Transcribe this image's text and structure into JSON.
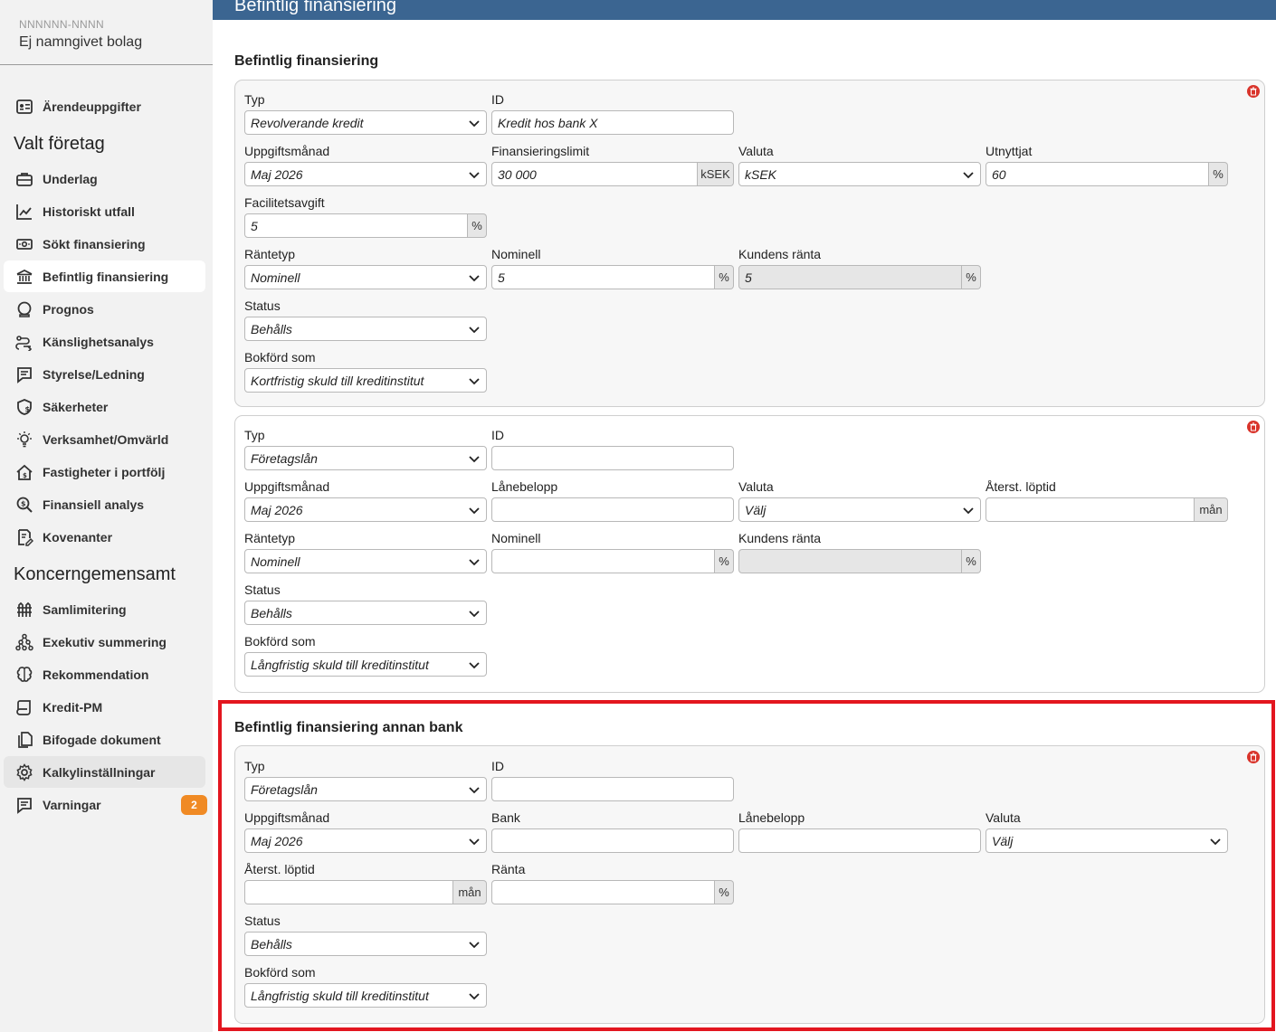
{
  "sidebar": {
    "company_id": "NNNNNN-NNNN",
    "company_name": "Ej namngivet bolag",
    "items_top": [
      {
        "label": "Ärendeuppgifter",
        "icon": "id-card-icon"
      }
    ],
    "section1": "Valt företag",
    "items1": [
      {
        "label": "Underlag",
        "icon": "briefcase-icon"
      },
      {
        "label": "Historiskt utfall",
        "icon": "chart-icon"
      },
      {
        "label": "Sökt finansiering",
        "icon": "money-icon"
      },
      {
        "label": "Befintlig finansiering",
        "icon": "bank-icon"
      },
      {
        "label": "Prognos",
        "icon": "crystal-ball-icon"
      },
      {
        "label": "Känslighetsanalys",
        "icon": "route-icon"
      },
      {
        "label": "Styrelse/Ledning",
        "icon": "comment-icon"
      },
      {
        "label": "Säkerheter",
        "icon": "shield-icon"
      },
      {
        "label": "Verksamhet/Omvärld",
        "icon": "lightbulb-icon"
      },
      {
        "label": "Fastigheter i portfölj",
        "icon": "house-icon"
      },
      {
        "label": "Finansiell analys",
        "icon": "magnifier-icon"
      },
      {
        "label": "Kovenanter",
        "icon": "document-pen-icon"
      }
    ],
    "section2": "Koncerngemensamt",
    "items2": [
      {
        "label": "Samlimitering",
        "icon": "fence-icon"
      },
      {
        "label": "Exekutiv summering",
        "icon": "hierarchy-icon"
      },
      {
        "label": "Rekommendation",
        "icon": "brain-icon"
      },
      {
        "label": "Kredit-PM",
        "icon": "scroll-icon"
      },
      {
        "label": "Bifogade dokument",
        "icon": "files-icon"
      },
      {
        "label": "Kalkylinställningar",
        "icon": "gear-icon"
      },
      {
        "label": "Varningar",
        "icon": "alert-comment-icon",
        "badge": "2"
      }
    ]
  },
  "header": {
    "title": "Befintlig finansiering"
  },
  "section_existing": {
    "title": "Befintlig finansiering"
  },
  "card1": {
    "typ_label": "Typ",
    "typ_value": "Revolverande kredit",
    "id_label": "ID",
    "id_value": "Kredit hos bank X",
    "month_label": "Uppgiftsmånad",
    "month_value": "Maj 2026",
    "limit_label": "Finansieringslimit",
    "limit_value": "30 000",
    "limit_unit": "kSEK",
    "currency_label": "Valuta",
    "currency_value": "kSEK",
    "used_label": "Utnyttjat",
    "used_value": "60",
    "used_unit": "%",
    "fee_label": "Facilitetsavgift",
    "fee_value": "5",
    "fee_unit": "%",
    "ratetype_label": "Räntetyp",
    "ratetype_value": "Nominell",
    "nominal_label": "Nominell",
    "nominal_value": "5",
    "nominal_unit": "%",
    "customer_rate_label": "Kundens ränta",
    "customer_rate_value": "5",
    "customer_rate_unit": "%",
    "status_label": "Status",
    "status_value": "Behålls",
    "booked_label": "Bokförd som",
    "booked_value": "Kortfristig skuld till kreditinstitut"
  },
  "card2": {
    "typ_label": "Typ",
    "typ_value": "Företagslån",
    "id_label": "ID",
    "id_value": "",
    "month_label": "Uppgiftsmånad",
    "month_value": "Maj 2026",
    "loan_label": "Lånebelopp",
    "loan_value": "",
    "currency_label": "Valuta",
    "currency_value": "Välj",
    "remaining_label": "Återst. löptid",
    "remaining_value": "",
    "remaining_unit": "mån",
    "ratetype_label": "Räntetyp",
    "ratetype_value": "Nominell",
    "nominal_label": "Nominell",
    "nominal_value": "",
    "nominal_unit": "%",
    "customer_rate_label": "Kundens ränta",
    "customer_rate_value": "",
    "customer_rate_unit": "%",
    "status_label": "Status",
    "status_value": "Behålls",
    "booked_label": "Bokförd som",
    "booked_value": "Långfristig skuld till kreditinstitut"
  },
  "section_other": {
    "title": "Befintlig finansiering annan bank"
  },
  "card3": {
    "typ_label": "Typ",
    "typ_value": "Företagslån",
    "id_label": "ID",
    "id_value": "",
    "month_label": "Uppgiftsmånad",
    "month_value": "Maj 2026",
    "bank_label": "Bank",
    "bank_value": "",
    "loan_label": "Lånebelopp",
    "loan_value": "",
    "currency_label": "Valuta",
    "currency_value": "Välj",
    "remaining_label": "Återst. löptid",
    "remaining_value": "",
    "remaining_unit": "mån",
    "rate_label": "Ränta",
    "rate_value": "",
    "rate_unit": "%",
    "status_label": "Status",
    "status_value": "Behålls",
    "booked_label": "Bokförd som",
    "booked_value": "Långfristig skuld till kreditinstitut"
  },
  "colors": {
    "header": "#3b6591",
    "highlight": "#e3161f",
    "badge": "#f08a24",
    "trash": "#d9342b"
  }
}
